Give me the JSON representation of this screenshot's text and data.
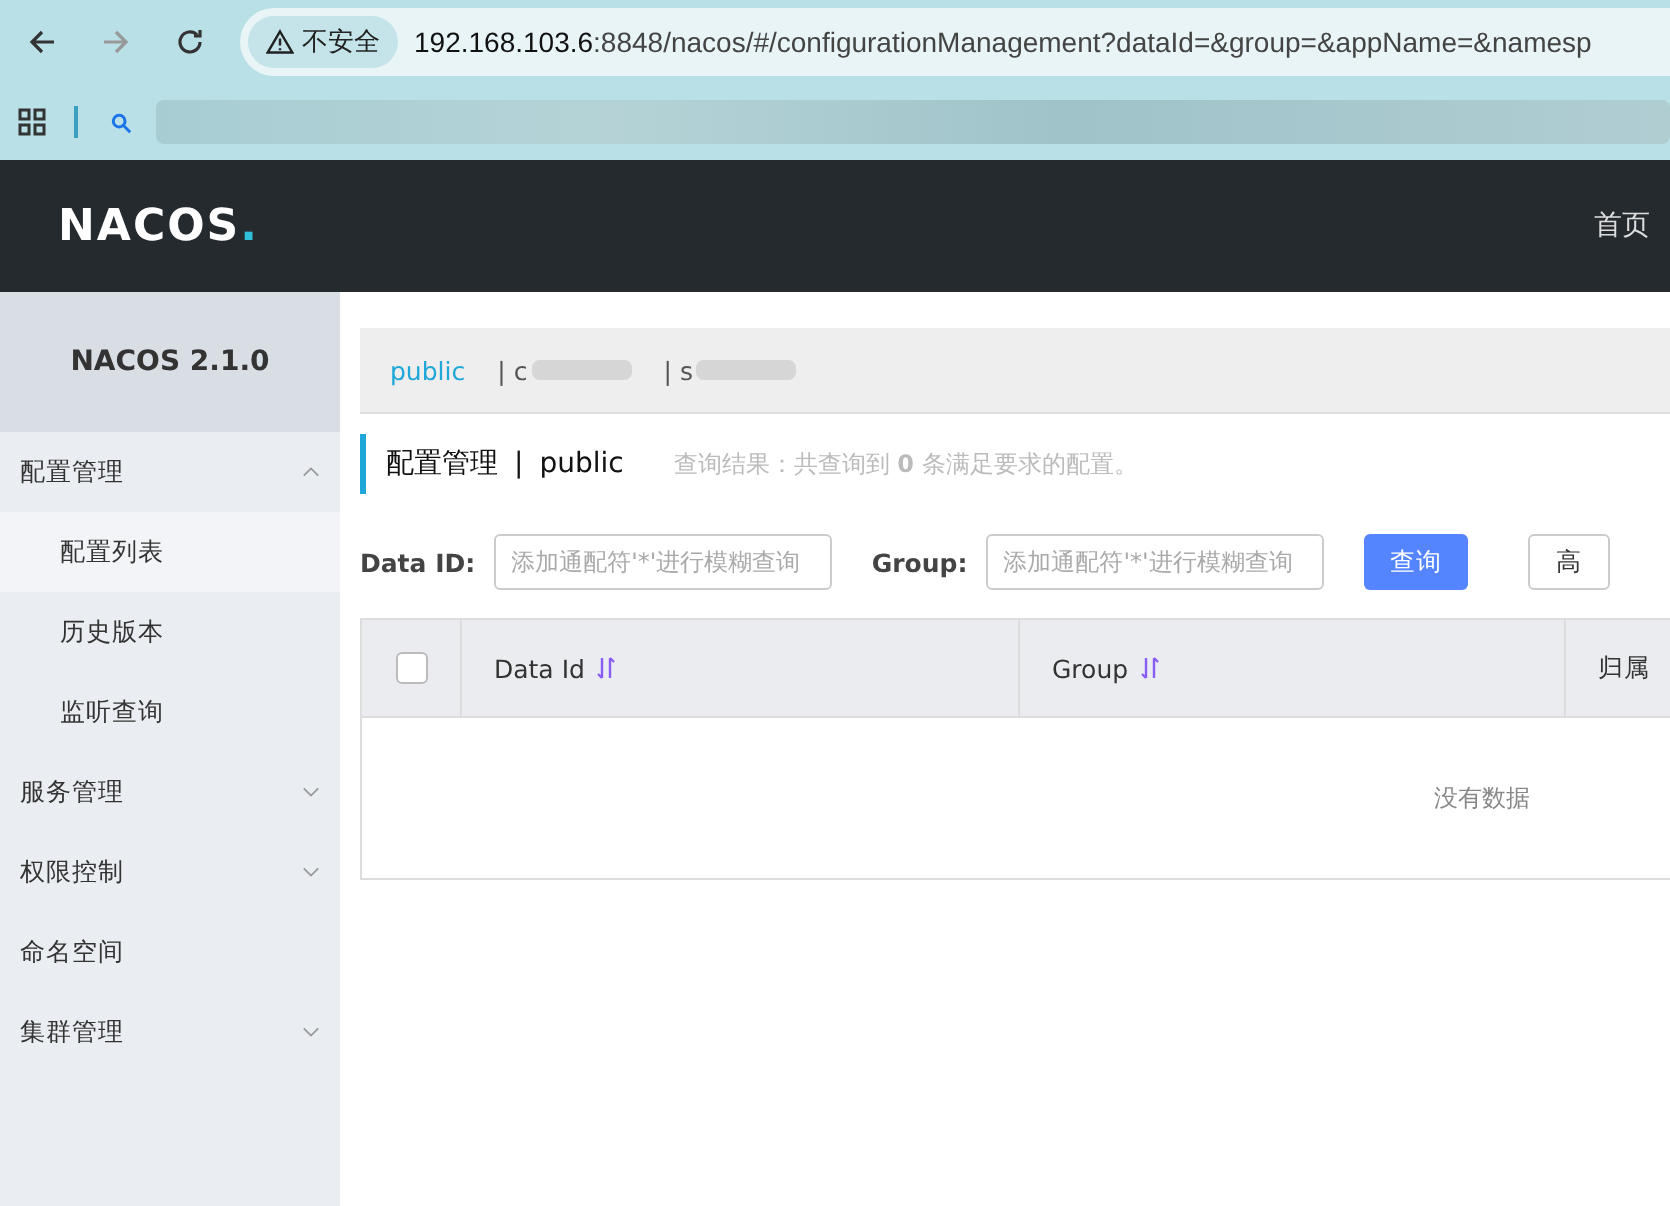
{
  "browser": {
    "security_label": "不安全",
    "url_host": "192.168.103.6",
    "url_rest": ":8848/nacos/#/configurationManagement?dataId=&group=&appName=&namesp"
  },
  "header": {
    "logo": "NACOS",
    "logo_dot": ".",
    "nav": "首页"
  },
  "sidebar": {
    "version": "NACOS 2.1.0",
    "items": [
      {
        "label": "配置管理",
        "expanded": true,
        "children": [
          {
            "label": "配置列表",
            "selected": true
          },
          {
            "label": "历史版本",
            "selected": false
          },
          {
            "label": "监听查询",
            "selected": false
          }
        ]
      },
      {
        "label": "服务管理",
        "expanded": false
      },
      {
        "label": "权限控制",
        "expanded": false
      },
      {
        "label": "命名空间"
      },
      {
        "label": "集群管理",
        "expanded": false
      }
    ]
  },
  "namespaces": [
    {
      "label": "public",
      "selected": true
    },
    {
      "separator": "|",
      "label": "c",
      "selected": false
    },
    {
      "separator": "|",
      "label": "s",
      "selected": false
    }
  ],
  "page": {
    "title": "配置管理",
    "separator": "|",
    "namespace": "public",
    "result": "查询结果：共查询到 **0** 条满足要求的配置。"
  },
  "filters": [
    {
      "label": "Data ID:",
      "placeholder": "添加通配符'*'进行模糊查询"
    },
    {
      "label": "Group:",
      "placeholder": "添加通配符'*'进行模糊查询"
    }
  ],
  "buttons": [
    {
      "label": "查询",
      "kind": "primary"
    },
    {
      "label": "高",
      "kind": "normal"
    }
  ],
  "table": {
    "select_all": {
      "checked": false
    },
    "columns": [
      {
        "label": "Data Id",
        "sortable": true
      },
      {
        "label": "Group",
        "sortable": true
      },
      {
        "label": "归属",
        "sortable": false
      }
    ],
    "empty": "没有数据"
  }
}
